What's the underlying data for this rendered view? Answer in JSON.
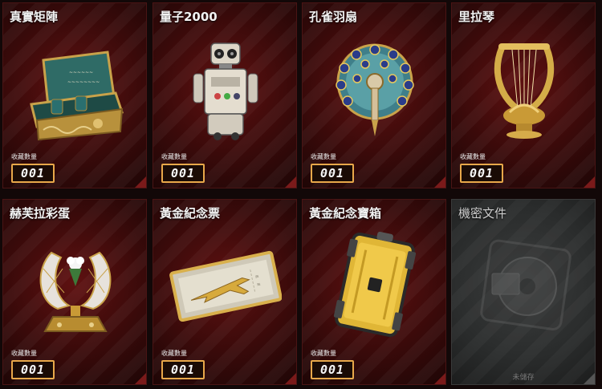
{
  "collection": {
    "count_label": "收藏數量",
    "items": [
      {
        "name": "真實矩陣",
        "count": "001",
        "icon": "jewel-box-icon"
      },
      {
        "name": "量子2000",
        "count": "001",
        "icon": "robot-icon"
      },
      {
        "name": "孔雀羽扇",
        "count": "001",
        "icon": "peacock-fan-icon"
      },
      {
        "name": "里拉琴",
        "count": "001",
        "icon": "lyre-icon"
      },
      {
        "name": "赫芙拉彩蛋",
        "count": "001",
        "icon": "jeweled-egg-icon"
      },
      {
        "name": "黃金紀念票",
        "count": "001",
        "icon": "gold-ticket-icon"
      },
      {
        "name": "黃金紀念寶箱",
        "count": "001",
        "icon": "gold-case-icon"
      },
      {
        "name": "機密文件",
        "status": "未儲存",
        "icon": "hard-disk-icon",
        "locked": true
      }
    ]
  },
  "colors": {
    "card_bg": "#3a0a0a",
    "card_border": "#4a1414",
    "locked_bg": "#2a2c2c",
    "count_frame": "#e8a84a",
    "count_text": "#f7f7f7"
  }
}
